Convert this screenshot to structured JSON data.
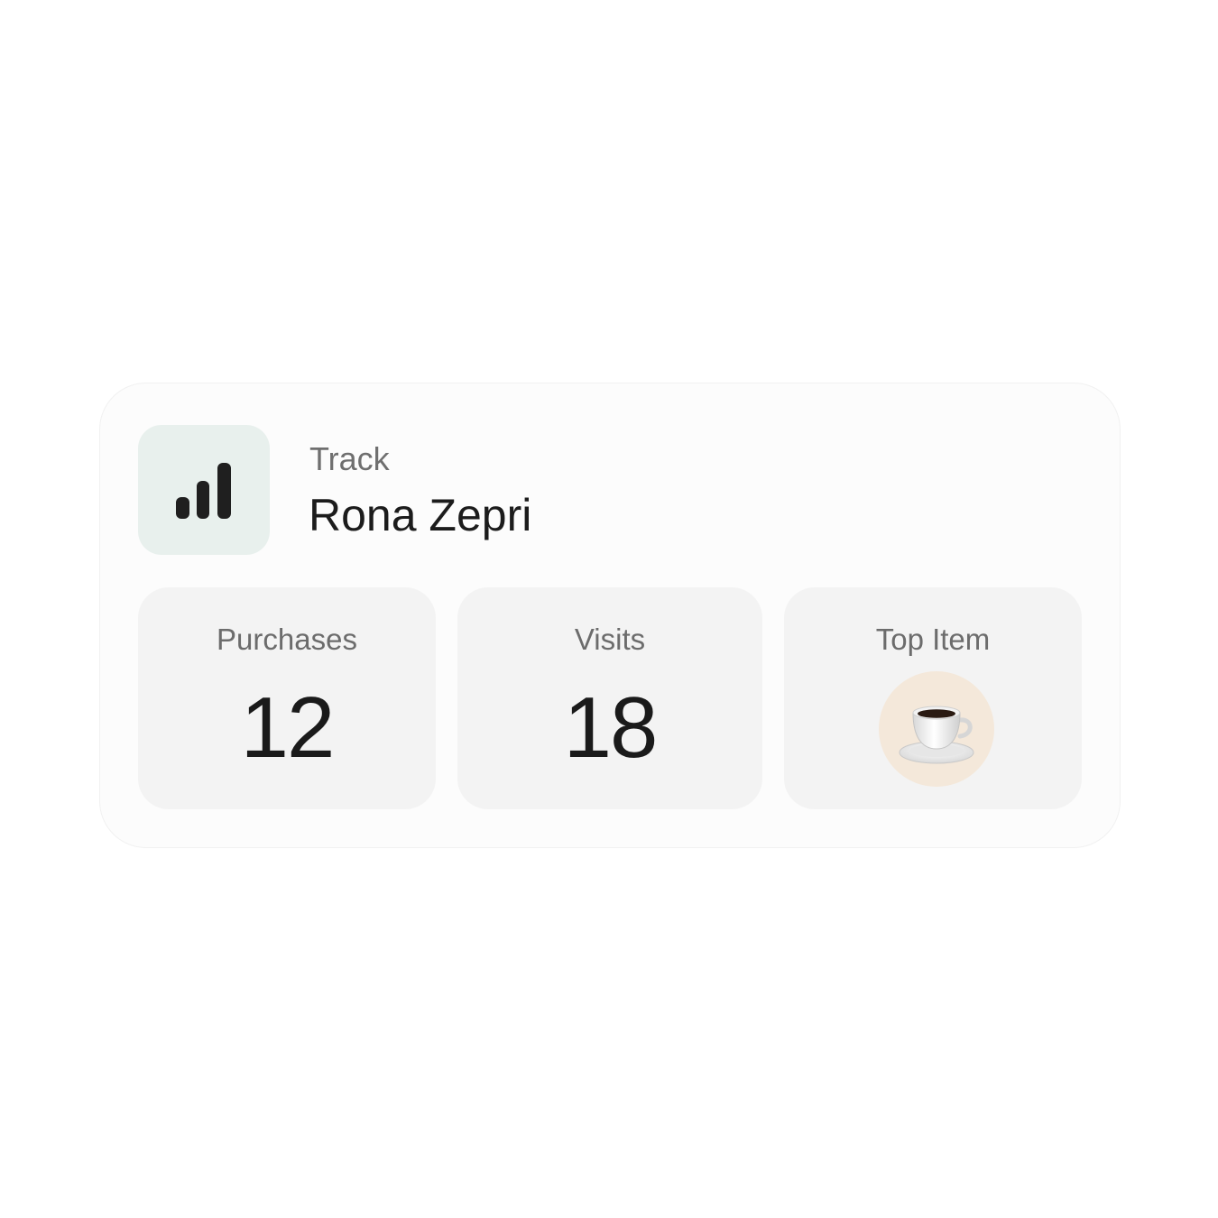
{
  "header": {
    "subtitle": "Track",
    "name": "Rona Zepri",
    "icon": "bar-chart-icon"
  },
  "stats": {
    "purchases": {
      "label": "Purchases",
      "value": "12"
    },
    "visits": {
      "label": "Visits",
      "value": "18"
    },
    "top_item": {
      "label": "Top Item",
      "icon": "coffee-cup-icon"
    }
  },
  "colors": {
    "icon_box_bg": "#e8f0ed",
    "tile_bg": "#f3f3f3",
    "top_item_circle": "#f4e8da"
  }
}
